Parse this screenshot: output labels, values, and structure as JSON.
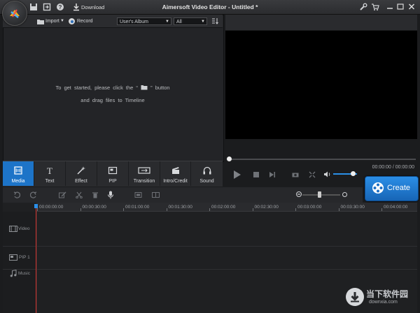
{
  "titlebar": {
    "title": "Aimersoft Video Editor - Untitled *",
    "download_label": "Download"
  },
  "media": {
    "import_label": "Import",
    "record_label": "Record",
    "album_select": "User's Album",
    "filter_select": "All",
    "hint_prefix": "To get started, please click the “",
    "hint_suffix": "” button",
    "hint_line2": "and drag files to Timeline"
  },
  "tabs": [
    {
      "label": "Media",
      "icon": "media-icon",
      "active": true
    },
    {
      "label": "Text",
      "icon": "text-icon"
    },
    {
      "label": "Effect",
      "icon": "effect-icon"
    },
    {
      "label": "PIP",
      "icon": "pip-icon"
    },
    {
      "label": "Transition",
      "icon": "transition-icon"
    },
    {
      "label": "Intro/Credit",
      "icon": "clapper-icon"
    },
    {
      "label": "Sound",
      "icon": "headphones-icon"
    }
  ],
  "preview": {
    "timecode": "00:00:00 / 00:00:00",
    "volume_level": 0.85
  },
  "create_label": "Create",
  "timeline": {
    "ticks": [
      "00:00:00:00",
      "00:00:30:00",
      "00:01:00:00",
      "00:01:30:00",
      "00:02:00:00",
      "00:02:30:00",
      "00:03:00:00",
      "00:03:30:00",
      "00:04:00:00"
    ],
    "tracks": [
      "Video",
      "PIP 1",
      "Music"
    ],
    "zoom_level": 0.45
  },
  "watermark": {
    "cn": "当下软件园",
    "url": "downxia.com"
  },
  "colors": {
    "accent": "#1d74c8",
    "playhead": "#d0302b"
  }
}
